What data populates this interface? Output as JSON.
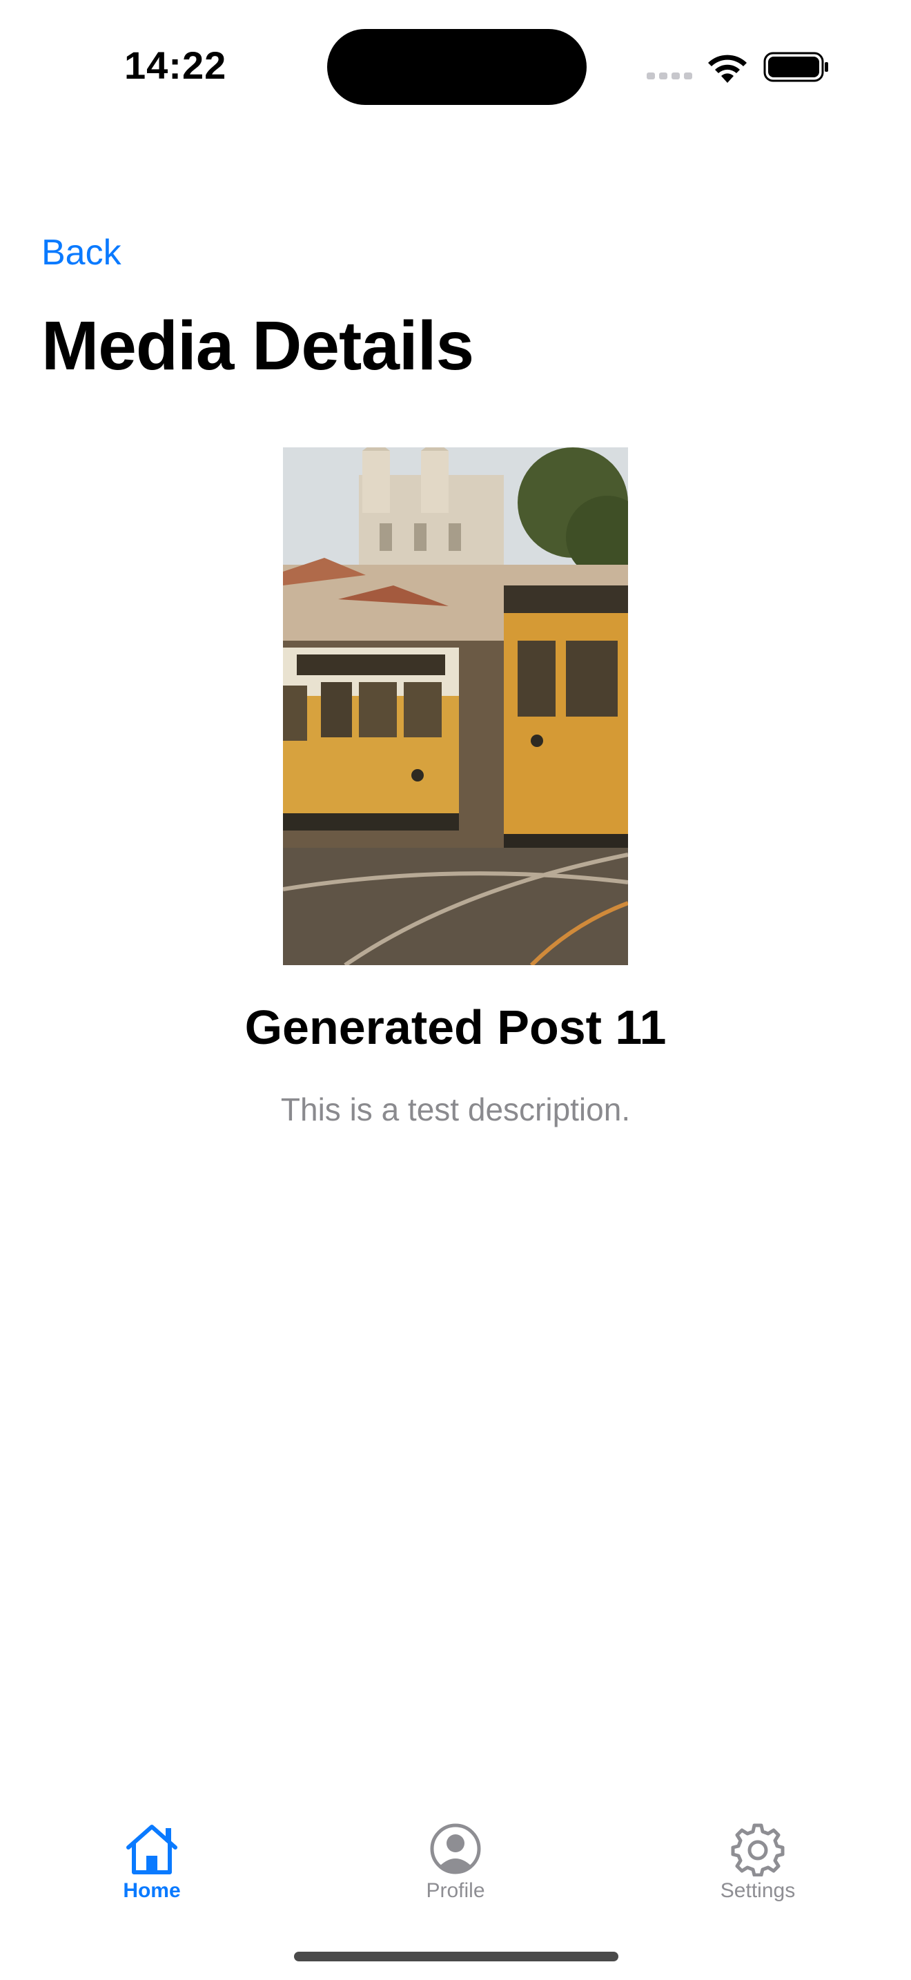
{
  "status_bar": {
    "time": "14:22"
  },
  "nav": {
    "back_label": "Back",
    "title": "Media Details"
  },
  "post": {
    "title": "Generated Post 11",
    "description": "This is a test description."
  },
  "tab_bar": {
    "tabs": [
      {
        "label": "Home",
        "icon": "house-icon",
        "active": true
      },
      {
        "label": "Profile",
        "icon": "person-circle-icon",
        "active": false
      },
      {
        "label": "Settings",
        "icon": "gear-icon",
        "active": false
      }
    ]
  },
  "colors": {
    "accent": "#0a7aff",
    "inactive": "#8e8e93",
    "description": "#8a8a8e"
  }
}
